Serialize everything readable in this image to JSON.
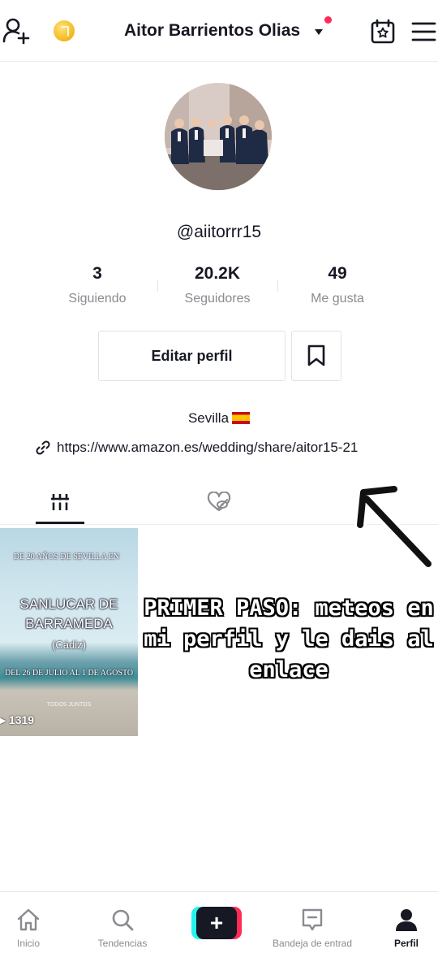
{
  "header": {
    "username": "Aitor Barrientos Olias",
    "icons": [
      "add-user-icon",
      "coin-icon",
      "chevron-down-icon",
      "calendar-icon",
      "menu-icon"
    ],
    "notification_dot_color": "#fe2c55"
  },
  "profile": {
    "handle": "@aiitorrr15",
    "stats": [
      {
        "value": "3",
        "label": "Siguiendo"
      },
      {
        "value": "20.2K",
        "label": "Seguidores"
      },
      {
        "value": "49",
        "label": "Me gusta"
      }
    ],
    "edit_label": "Editar perfil",
    "bio": "Sevilla",
    "link": "https://www.amazon.es/wedding/share/aitor15-21"
  },
  "tabs": [
    {
      "icon": "grid-icon",
      "active": true
    },
    {
      "icon": "liked-hidden-icon",
      "active": false
    }
  ],
  "video": {
    "line1": "DE 20 AÑOS DE SEVILLA EN",
    "title": "SANLUCAR DE BARRAMEDA",
    "subtitle": "(Cádiz)",
    "dates": "DEL 26 DE JULIO AL 1 DE AGOSTO",
    "small": "TODOS JUNTOS",
    "views": "1319"
  },
  "overlay": {
    "text": "PRIMER PASO: meteos en mi perfil y le dais al enlace"
  },
  "bottom_nav": [
    {
      "label": "Inicio",
      "icon": "home-icon"
    },
    {
      "label": "Tendencias",
      "icon": "search-icon"
    },
    {
      "label": "",
      "icon": "plus-icon"
    },
    {
      "label": "Bandeja de entrad",
      "icon": "inbox-icon"
    },
    {
      "label": "Perfil",
      "icon": "profile-icon"
    }
  ],
  "colors": {
    "accent": "#fe2c55",
    "cyan": "#25f4ee",
    "text": "#161823",
    "muted": "#8a8b91"
  }
}
